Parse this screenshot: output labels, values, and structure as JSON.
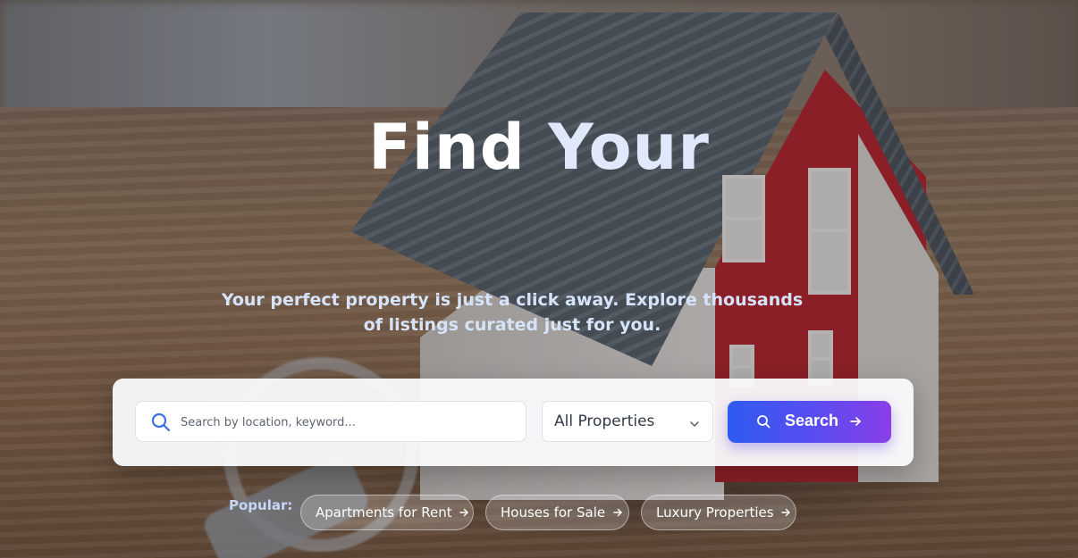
{
  "hero": {
    "title_main": "Find",
    "title_accent": "Your",
    "subtitle": "Your perfect property is just a click away. Explore thousands of listings curated just for you."
  },
  "search": {
    "placeholder": "Search by location, keyword...",
    "value": "",
    "property_type": {
      "selected": "All Properties"
    },
    "button_label": "Search"
  },
  "popular": {
    "label": "Popular:",
    "chips": [
      {
        "label": "Apartments for Rent"
      },
      {
        "label": "Houses for Sale"
      },
      {
        "label": "Luxury Properties"
      }
    ]
  },
  "colors": {
    "accent_start": "#2f5bf0",
    "accent_end": "#8b3ee8",
    "search_icon": "#3b6fe6",
    "title_accent": "#dfe9fb",
    "subtitle": "#d6e4fa"
  },
  "icons": {
    "search_field": "search-icon",
    "select": "chevron-down-icon",
    "button_left": "search-icon",
    "button_right": "arrow-right-icon",
    "chip": "arrow-right-icon"
  }
}
